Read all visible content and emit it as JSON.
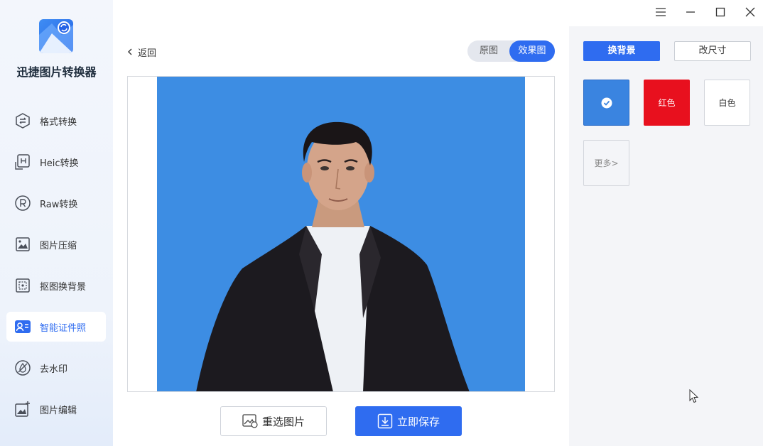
{
  "app": {
    "name": "迅捷图片转换器"
  },
  "sidebar": {
    "items": [
      {
        "label": "格式转换",
        "icon": "format-convert-icon"
      },
      {
        "label": "Heic转换",
        "icon": "heic-icon"
      },
      {
        "label": "Raw转换",
        "icon": "raw-icon"
      },
      {
        "label": "图片压缩",
        "icon": "image-compress-icon"
      },
      {
        "label": "抠图换背景",
        "icon": "cutout-icon"
      },
      {
        "label": "智能证件照",
        "icon": "id-photo-icon",
        "active": true
      },
      {
        "label": "去水印",
        "icon": "watermark-icon"
      },
      {
        "label": "图片编辑",
        "icon": "image-edit-icon"
      }
    ]
  },
  "header": {
    "back_label": "返回"
  },
  "view_toggle": {
    "original": "原图",
    "effect": "效果图",
    "selected": "效果图"
  },
  "actions": {
    "reselect": "重选图片",
    "save": "立即保存"
  },
  "right_panel": {
    "tabs": [
      {
        "label": "换背景",
        "active": true
      },
      {
        "label": "改尺寸",
        "active": false
      }
    ],
    "swatches": [
      {
        "label": "",
        "color": "#3a84e0",
        "selected": true
      },
      {
        "label": "红色",
        "color": "#e8101e"
      },
      {
        "label": "白色",
        "color": "#ffffff"
      }
    ],
    "more": "更多>"
  },
  "colors": {
    "accent": "#2f6cf0",
    "photo_background": "#3d8de3"
  }
}
